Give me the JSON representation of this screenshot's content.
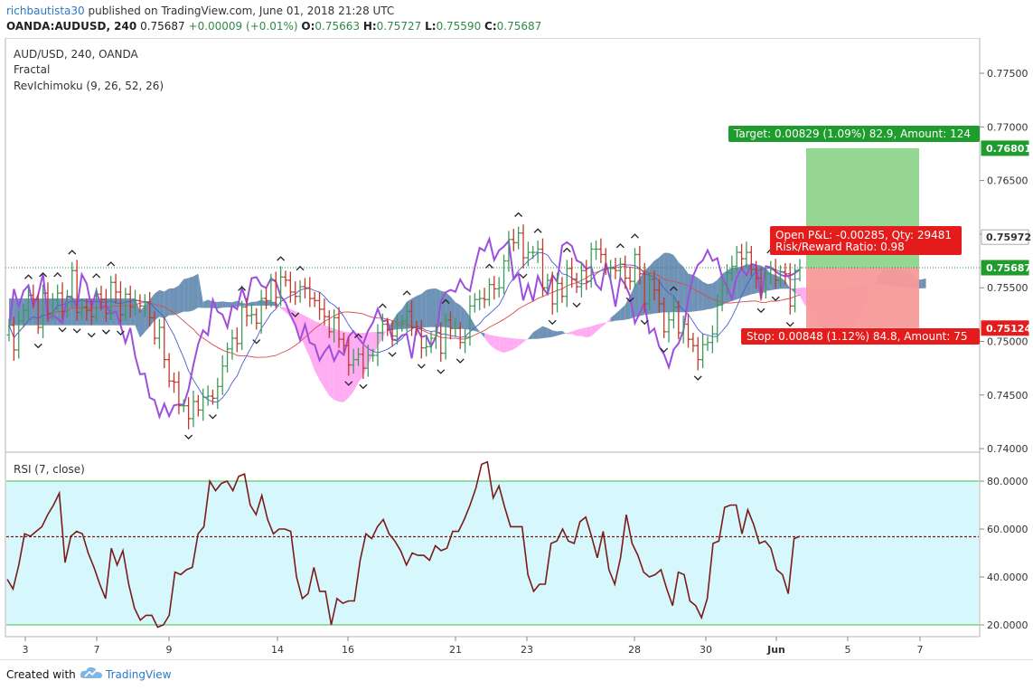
{
  "header": {
    "publisher": "richbautista30",
    "published_text": "published on TradingView.com, June 01, 2018 21:28 UTC",
    "symbol": "OANDA:AUDUSD, 240",
    "last": "0.75687",
    "change": "+0.00009 (+0.01%)",
    "o_label": "O:",
    "o": "0.75663",
    "h_label": "H:",
    "h": "0.75727",
    "l_label": "L:",
    "l": "0.75590",
    "c_label": "C:",
    "c": "0.75687"
  },
  "legend": {
    "title": "AUD/USD, 240, OANDA",
    "indicator1": "Fractal",
    "indicator2": "RevIchimoku (9, 26, 52, 26)"
  },
  "rsi_panel": {
    "title": "RSI (7, close)"
  },
  "footer": {
    "created_with": "Created with",
    "brand": "TradingView"
  },
  "colors": {
    "up": "#3d9b5a",
    "down": "#c0392b",
    "purple": "#9d4edd",
    "blue": "#4b5bd6",
    "red_line": "#d94b4b",
    "cloud_pink": "#ff9ef0",
    "cloud_blue": "#3f6f9e",
    "rsi_line": "#7a1c1c",
    "rsi_bg": "#d6f7fb",
    "target": "#8fd48c",
    "stop": "#f79a9a",
    "tag_green": "#1e9c2d",
    "tag_red": "#e51c1c"
  },
  "chart_data": {
    "type": "candlestick",
    "price_axis": {
      "ticks": [
        "0.77500",
        "0.77000",
        "0.76500",
        "0.76000",
        "0.75500",
        "0.75000",
        "0.74500",
        "0.74000"
      ],
      "ylim": [
        0.7393,
        0.7775
      ]
    },
    "price_tags": [
      {
        "label": "0.76801",
        "value": 0.76801,
        "color": "green"
      },
      {
        "label": "0.75972",
        "value": 0.75972,
        "color": "gray"
      },
      {
        "label": "0.75687",
        "value": 0.75687,
        "color": "green"
      },
      {
        "label": "0.75124",
        "value": 0.75124,
        "color": "red"
      }
    ],
    "x_ticks": [
      "3",
      "7",
      "9",
      "14",
      "16",
      "21",
      "23",
      "28",
      "30",
      "Jun",
      "5",
      "7"
    ],
    "candles": {
      "open": [
        0.7506,
        0.7515,
        0.7492,
        0.7519,
        0.7529,
        0.7543,
        0.7539,
        0.7513,
        0.7545,
        0.7526,
        0.7539,
        0.7545,
        0.7528,
        0.7542,
        0.7566,
        0.7527,
        0.7532,
        0.7529,
        0.7523,
        0.7544,
        0.7539,
        0.7526,
        0.7555,
        0.7546,
        0.7525,
        0.7544,
        0.7532,
        0.7538,
        0.7533,
        0.7536,
        0.7522,
        0.7503,
        0.7513,
        0.7483,
        0.7463,
        0.7462,
        0.744,
        0.744,
        0.7428,
        0.7444,
        0.7436,
        0.7448,
        0.7449,
        0.7447,
        0.7458,
        0.7477,
        0.7493,
        0.7503,
        0.7498,
        0.7532,
        0.7524,
        0.7525,
        0.7517,
        0.754,
        0.7538,
        0.7557,
        0.7541,
        0.756,
        0.7557,
        0.7546,
        0.7542,
        0.7551,
        0.755,
        0.754,
        0.7538,
        0.753,
        0.7523,
        0.7509,
        0.7522,
        0.7502,
        0.7496,
        0.7478,
        0.7483,
        0.7488,
        0.7475,
        0.7487,
        0.7487,
        0.7508,
        0.7516,
        0.7511,
        0.7505,
        0.7515,
        0.7519,
        0.7528,
        0.7513,
        0.7512,
        0.7494,
        0.7495,
        0.7503,
        0.7508,
        0.7489,
        0.752,
        0.7512,
        0.7512,
        0.7499,
        0.7504,
        0.7533,
        0.7539,
        0.754,
        0.7539,
        0.7553,
        0.7549,
        0.755,
        0.7575,
        0.7595,
        0.7592,
        0.7601,
        0.7578,
        0.7583,
        0.7583,
        0.7586,
        0.755,
        0.7557,
        0.7535,
        0.7554,
        0.7542,
        0.7568,
        0.7558,
        0.7551,
        0.7566,
        0.7556,
        0.7586,
        0.7586,
        0.7581,
        0.7568,
        0.7568,
        0.7566,
        0.7572,
        0.7559,
        0.7556,
        0.7581,
        0.7563,
        0.7535,
        0.7558,
        0.7548,
        0.7535,
        0.7509,
        0.752,
        0.7532,
        0.7508,
        0.7516,
        0.7502,
        0.7496,
        0.7483,
        0.7497,
        0.7499,
        0.7507,
        0.7534,
        0.7553,
        0.7564,
        0.757,
        0.7583,
        0.7577,
        0.7583,
        0.7567,
        0.7559,
        0.7546,
        0.7563,
        0.7567,
        0.7557,
        0.7565,
        0.7563,
        0.7533,
        0.7566
      ],
      "close": [
        0.7515,
        0.7492,
        0.7519,
        0.7529,
        0.7543,
        0.7539,
        0.7513,
        0.7545,
        0.7526,
        0.7539,
        0.7545,
        0.7528,
        0.7542,
        0.7566,
        0.7527,
        0.7532,
        0.7529,
        0.7523,
        0.7544,
        0.7539,
        0.7526,
        0.7555,
        0.7546,
        0.7525,
        0.7544,
        0.7532,
        0.7538,
        0.7533,
        0.7536,
        0.7522,
        0.7503,
        0.7513,
        0.7483,
        0.7463,
        0.7462,
        0.744,
        0.744,
        0.7428,
        0.7444,
        0.7436,
        0.7448,
        0.7449,
        0.7447,
        0.7458,
        0.7477,
        0.7493,
        0.7503,
        0.7498,
        0.7532,
        0.7524,
        0.7525,
        0.7517,
        0.754,
        0.7538,
        0.7557,
        0.7541,
        0.756,
        0.7557,
        0.7546,
        0.7542,
        0.7551,
        0.755,
        0.754,
        0.7538,
        0.753,
        0.7523,
        0.7509,
        0.7522,
        0.7502,
        0.7496,
        0.7478,
        0.7483,
        0.7488,
        0.7475,
        0.7487,
        0.7487,
        0.7508,
        0.7516,
        0.7511,
        0.7505,
        0.7515,
        0.7519,
        0.7528,
        0.7513,
        0.7512,
        0.7494,
        0.7495,
        0.7503,
        0.7508,
        0.7489,
        0.752,
        0.7512,
        0.7512,
        0.7499,
        0.7504,
        0.7533,
        0.7539,
        0.754,
        0.7539,
        0.7553,
        0.7549,
        0.755,
        0.7575,
        0.7595,
        0.7592,
        0.7601,
        0.7578,
        0.7583,
        0.7583,
        0.7586,
        0.755,
        0.7557,
        0.7535,
        0.7554,
        0.7542,
        0.7568,
        0.7558,
        0.7551,
        0.7566,
        0.7556,
        0.7586,
        0.7586,
        0.7581,
        0.7568,
        0.7568,
        0.7566,
        0.7572,
        0.7559,
        0.7556,
        0.7581,
        0.7563,
        0.7535,
        0.7558,
        0.7548,
        0.7535,
        0.7509,
        0.752,
        0.7532,
        0.7508,
        0.7516,
        0.7502,
        0.7496,
        0.7483,
        0.7497,
        0.7499,
        0.7507,
        0.7534,
        0.7553,
        0.7564,
        0.757,
        0.7583,
        0.7577,
        0.7583,
        0.7567,
        0.7559,
        0.7546,
        0.7563,
        0.7567,
        0.7557,
        0.7565,
        0.7563,
        0.7533,
        0.7566,
        0.75687
      ]
    },
    "target_box": {
      "entry": 0.75687,
      "target": 0.76801,
      "stop": 0.75124
    },
    "target_label": "Target: 0.00829 (1.09%) 82.9, Amount: 124",
    "pnl_label_1": "Open P&L: -0.00285, Qty: 29481",
    "pnl_label_2": "Risk/Reward Ratio: 0.98",
    "stop_label": "Stop: 0.00848 (1.12%) 84.8, Amount: 75",
    "rsi": {
      "ticks": [
        "80.0000",
        "60.0000",
        "40.0000",
        "20.0000"
      ],
      "ylim": [
        15,
        89
      ],
      "upper": 80,
      "lower": 20,
      "last": 56.8,
      "values": [
        39,
        35,
        45,
        58,
        57,
        59,
        61,
        66,
        70,
        75,
        46,
        57,
        59,
        58,
        50,
        44,
        37,
        31,
        52,
        45,
        51,
        37,
        27,
        22,
        24,
        24,
        19,
        20,
        24,
        42,
        41,
        43,
        44,
        58,
        61,
        80,
        76,
        79,
        80,
        76,
        82,
        83,
        70,
        66,
        74,
        64,
        58,
        60,
        60,
        59,
        40,
        31,
        33,
        44,
        34,
        34,
        20,
        31,
        29,
        30,
        30,
        47,
        58,
        56,
        61,
        64,
        58,
        55,
        51,
        45,
        50,
        49,
        49,
        47,
        53,
        51,
        52,
        59,
        59,
        64,
        70,
        77,
        87,
        88,
        73,
        78,
        69,
        61,
        61,
        61,
        41,
        34,
        37,
        37,
        54,
        55,
        60,
        55,
        54,
        63,
        65,
        57,
        48,
        59,
        43,
        37,
        48,
        66,
        54,
        49,
        42,
        40,
        41,
        43,
        35,
        28,
        42,
        41,
        30,
        28,
        23,
        31,
        54,
        55,
        69,
        70,
        70,
        58,
        68,
        62,
        54,
        55,
        52,
        43,
        41,
        33,
        56,
        57
      ]
    }
  }
}
